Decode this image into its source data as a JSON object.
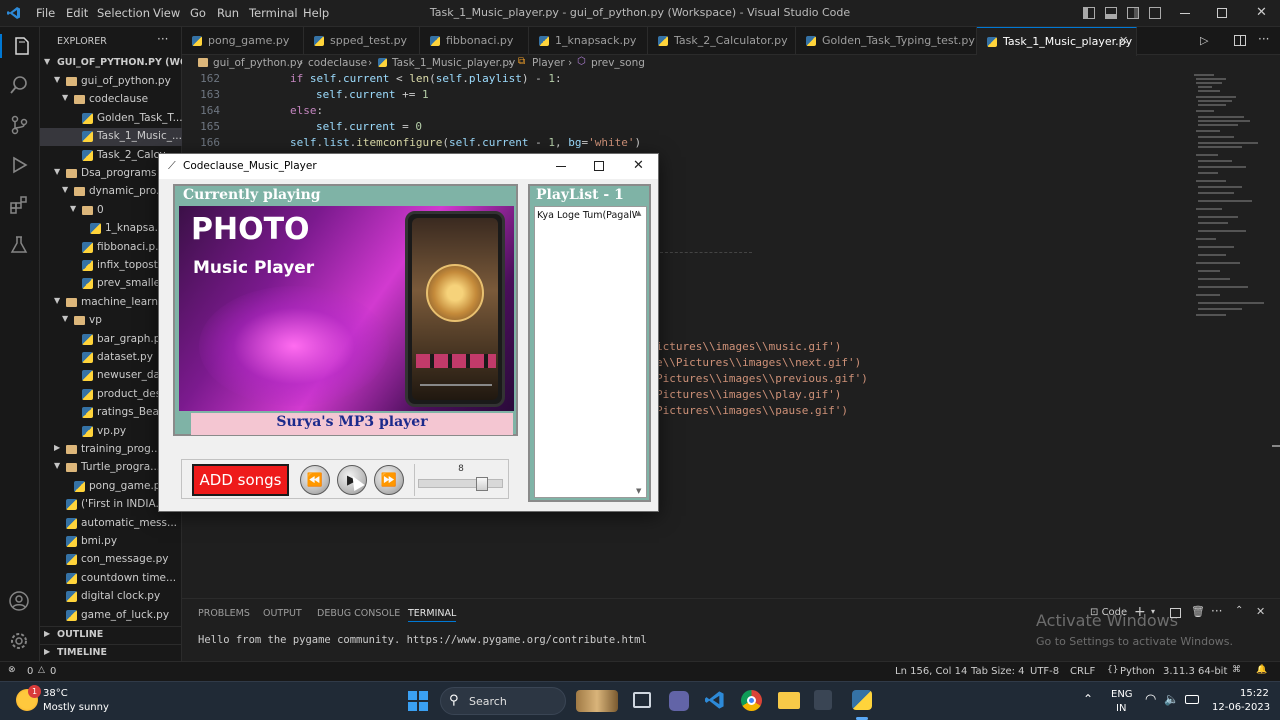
{
  "window": {
    "title": "Task_1_Music_player.py - gui_of_python.py (Workspace) - Visual Studio Code",
    "menus": [
      "File",
      "Edit",
      "Selection",
      "View",
      "Go",
      "Run",
      "Terminal",
      "Help"
    ]
  },
  "sidebar": {
    "header": "EXPLORER",
    "workspace": "GUI_OF_PYTHON.PY (WOR...",
    "items": [
      "gui_of_python.py",
      "codeclause",
      "Golden_Task_T...",
      "Task_1_Music_...",
      "Task_2_Calcu...",
      "Dsa_programs",
      "dynamic_pro...",
      "0",
      "1_knapsa...",
      "fibbonaci.p...",
      "infix_topostf...",
      "prev_smaller...",
      "machine_learn...",
      "vp",
      "bar_graph.py",
      "dataset.py",
      "newuser_dat...",
      "product_des...",
      "ratings_Beau...",
      "vp.py",
      "training_prog...",
      "Turtle_progra...",
      "pong_game.py",
      "('First in INDIA...",
      "automatic_mess...",
      "bmi.py",
      "con_message.py",
      "countdown time...",
      "digital clock.py",
      "game_of_luck.py"
    ],
    "outline": "OUTLINE",
    "timeline": "TIMELINE"
  },
  "tabs": [
    "pong_game.py",
    "spped_test.py",
    "fibbonaci.py",
    "1_knapsack.py",
    "Task_2_Calculator.py",
    "Golden_Task_Typing_test.py",
    "Task_1_Music_player.py"
  ],
  "breadcrumb": [
    "gui_of_python.py",
    "codeclause",
    "Task_1_Music_player.py",
    "Player",
    "prev_song"
  ],
  "editor": {
    "line_numbers": [
      "162",
      "163",
      "164",
      "165",
      "166"
    ],
    "right_fragments": [
      "ictures\\\\images\\\\music.gif')",
      "e\\\\Pictures\\\\images\\\\next.gif')",
      "Pictures\\\\images\\\\previous.gif')",
      "Pictures\\\\images\\\\play.gif')",
      "Pictures\\\\images\\\\pause.gif')"
    ]
  },
  "panel": {
    "tabs": [
      "PROBLEMS",
      "OUTPUT",
      "DEBUG CONSOLE",
      "TERMINAL"
    ],
    "terminal_line": "Hello from the pygame community. https://www.pygame.org/contribute.html",
    "profile": "Code",
    "watermark_title": "Activate Windows",
    "watermark_sub": "Go to Settings to activate Windows."
  },
  "status": {
    "errors": "0",
    "warnings": "0",
    "position": "Ln 156, Col 14",
    "tab_size": "Tab Size: 4",
    "encoding": "UTF-8",
    "eol": "CRLF",
    "language": "Python",
    "interpreter": "3.11.3 64-bit"
  },
  "taskbar": {
    "weather_temp": "38°C",
    "weather_desc": "Mostly sunny",
    "weather_badge": "1",
    "search": "Search",
    "lang1": "ENG",
    "lang2": "IN",
    "time": "15:22",
    "date": "12-06-2023"
  },
  "music_player": {
    "title": "Codeclause_Music_Player",
    "now_label": "Currently playing",
    "art_title_1": "PHOTO",
    "art_title_2": "Music Player",
    "player_label": "Surya's MP3 player",
    "playlist_label": "PlayList - 1",
    "playlist_items": [
      "Kya Loge Tum(PagalW"
    ],
    "add_button": "ADD songs",
    "volume": 8,
    "volume_max": 10
  }
}
